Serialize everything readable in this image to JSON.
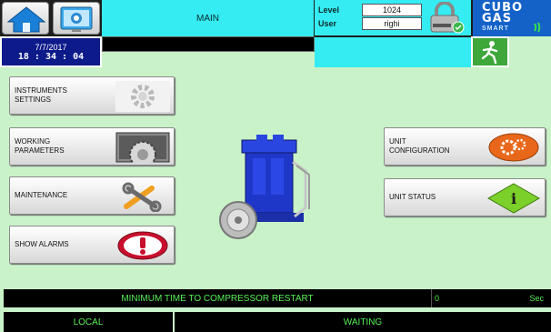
{
  "header": {
    "title": "MAIN",
    "level_label": "Level",
    "level_value": "1024",
    "user_label": "User",
    "user_value": "righi",
    "brand": {
      "line1": "CUBO",
      "line2": "GAS",
      "line3": "SMART"
    }
  },
  "datetime": {
    "date": "7/7/2017",
    "time": "18 : 34 : 04"
  },
  "menu": {
    "instruments_settings": "INSTRUMENTS\nSETTINGS",
    "working_parameters": "WORKING\nPARAMETERS",
    "maintenance": "MAINTENANCE",
    "show_alarms": "SHOW ALARMS",
    "unit_configuration": "UNIT\nCONFIGURATION",
    "unit_status": "UNIT STATUS"
  },
  "status": {
    "message": "MINIMUM TIME TO COMPRESSOR RESTART",
    "counter_value": "0",
    "counter_unit": "Sec",
    "mode": "LOCAL",
    "state": "WAITING"
  },
  "colors": {
    "background": "#c9f2c9",
    "header_cyan": "#34ecf2",
    "status_text": "#58f058",
    "date_bg": "#0c1a8a",
    "brand_bg": "#1462c8"
  },
  "icons": {
    "home": "home-icon",
    "info": "monitor-info-icon",
    "lock": "padlock-icon",
    "exit": "exit-running-man-icon",
    "instruments": "gear-icon",
    "working": "gear-wheel-icon",
    "maintenance": "tools-icon",
    "alarms": "alarm-icon",
    "configuration": "orange-gears-icon",
    "status": "info-diamond-icon",
    "compressor": "compressor-icon"
  }
}
